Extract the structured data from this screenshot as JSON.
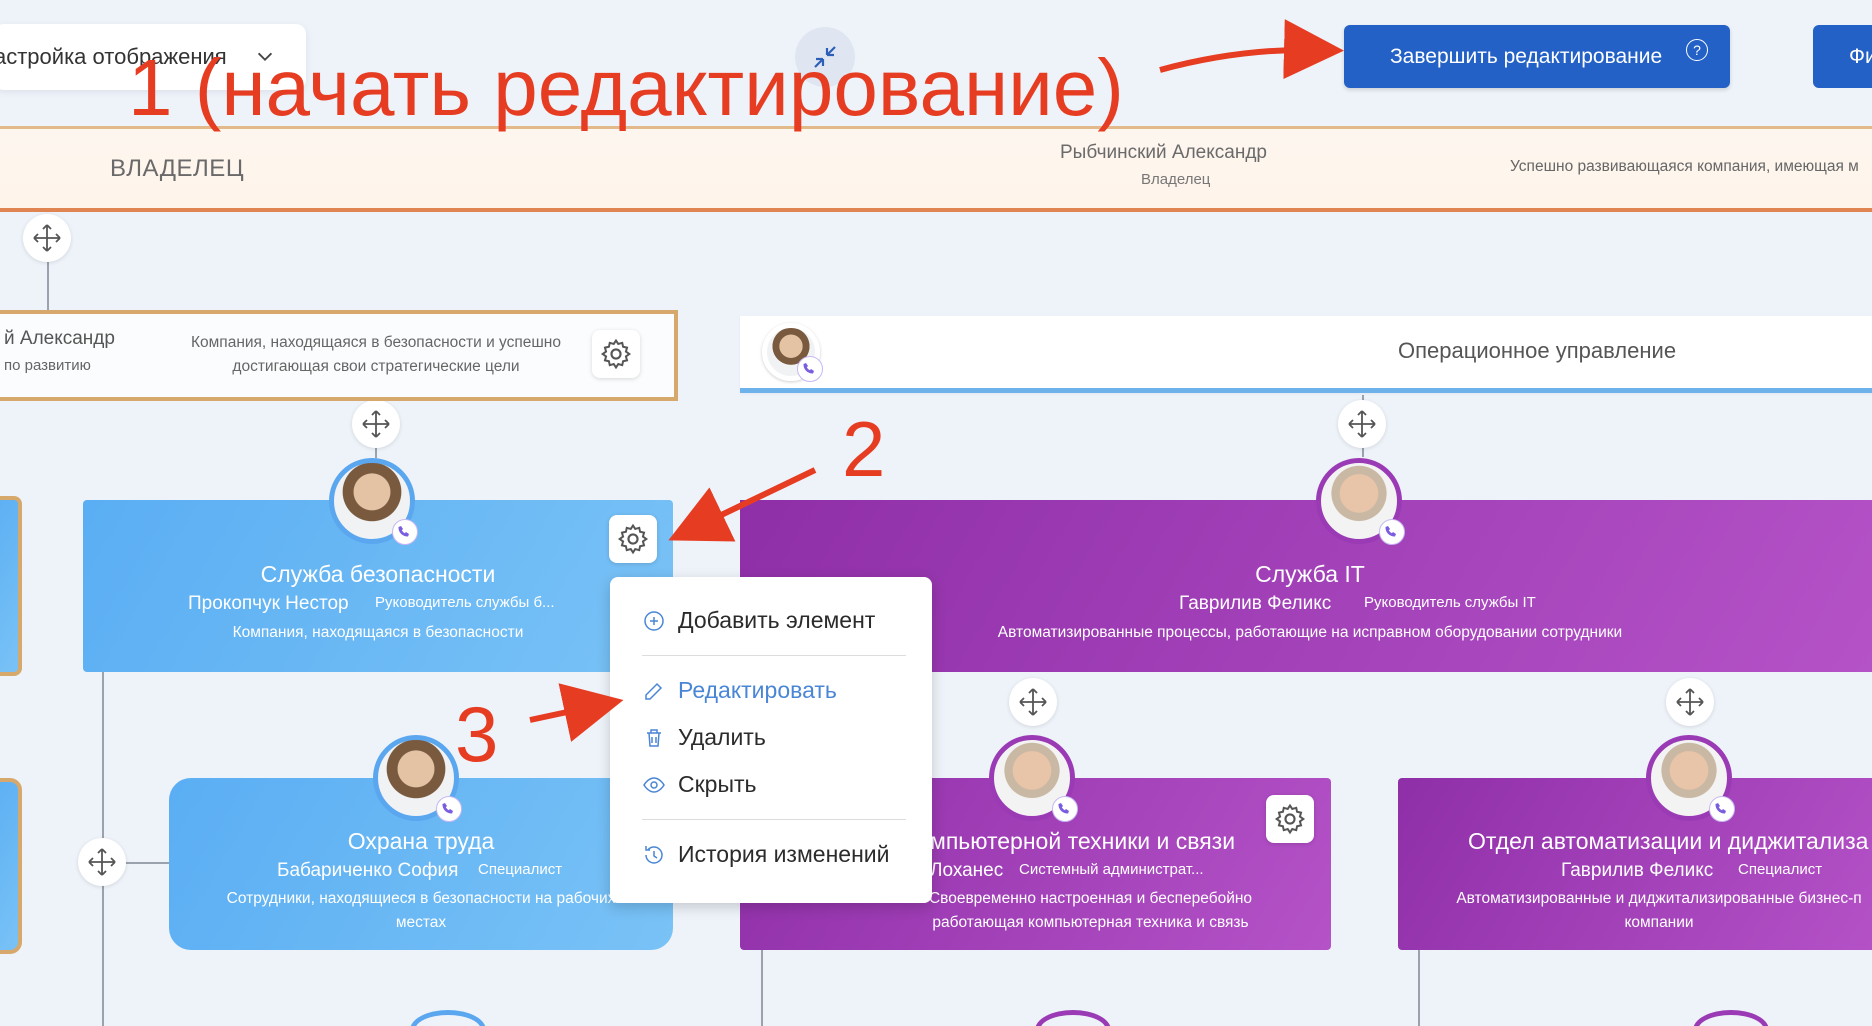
{
  "toolbar": {
    "display_settings_label": "астройка отображения",
    "finish_editing_label": "Завершить редактирование",
    "help_glyph": "?",
    "filter_label": "Фи"
  },
  "owner": {
    "role": "ВЛАДЕЛЕЦ",
    "name": "Рыбчинский Александр",
    "position": "Владелец",
    "description": "Успешно развивающаяся компания, имеющая м"
  },
  "divisions": {
    "left": {
      "name": "й Александр",
      "position": "по развитию",
      "description": "Компания, находящаяся в безопасности и успешно достигающая свои стратегические цели"
    },
    "right": {
      "title": "Операционное управление"
    }
  },
  "departments": {
    "security": {
      "title": "Служба безопасности",
      "person": "Прокопчук Нестор",
      "role": "Руководитель службы б...",
      "description": "Компания, находящаяся в безопасности"
    },
    "it": {
      "title": "Служба IT",
      "person": "Гаврилив Феликс",
      "role": "Руководитель службы IT",
      "description": "Автоматизированные процессы, работающие на исправном оборудовании сотрудники"
    },
    "labor": {
      "title": "Охрана труда",
      "person": "Бабариченко София",
      "role": "Специалист",
      "description": "Сотрудники, находящиеся в безопасности на рабочих местах"
    },
    "computers": {
      "title": "мпьютерной техники и связи",
      "person": "Лоханес",
      "role": "Системный администрат...",
      "description": "Своевременно настроенная и бесперебойно работающая компьютерная техника и связь"
    },
    "automation": {
      "title": "Отдел автоматизации и диджитализа",
      "person": "Гаврилив Феликс",
      "role": "Специалист",
      "description": "Автоматизированные и диджитализированные бизнес-п компании"
    }
  },
  "menu": {
    "add": "Добавить элемент",
    "edit": "Редактировать",
    "delete": "Удалить",
    "hide": "Скрыть",
    "history": "История изменений"
  },
  "annotations": {
    "step1": "1 (начать редактирование)",
    "step2": "2",
    "step3": "3"
  },
  "colors": {
    "primary_button": "#2361c6",
    "owner_border": "#e08552",
    "division_left_border": "#d6a86c",
    "division_right_border": "#6eb2ec",
    "blue_card": "#5aaef3",
    "purple_card": "#8f2fa8",
    "annotation": "#e63d22",
    "menu_active": "#4a86d6"
  }
}
